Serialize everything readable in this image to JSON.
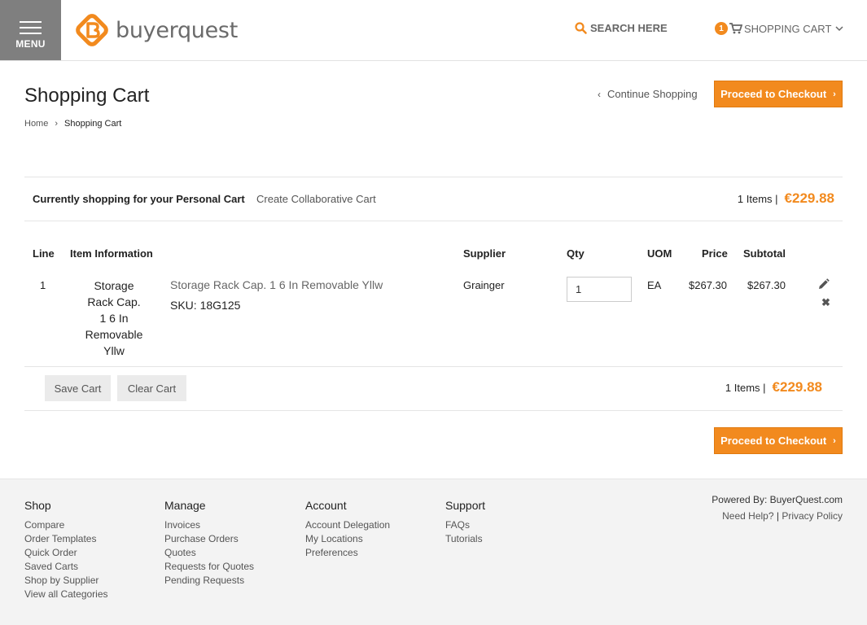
{
  "header": {
    "menu_label": "MENU",
    "logo_text": "buyerquest",
    "search_label": "SEARCH HERE",
    "cart_count": "1",
    "cart_label": "SHOPPING CART"
  },
  "page": {
    "title": "Shopping Cart",
    "breadcrumb": {
      "home": "Home",
      "current": "Shopping Cart"
    },
    "continue_label": "Continue Shopping",
    "checkout_label": "Proceed to Checkout"
  },
  "cart_bar": {
    "shopping_for": "Currently shopping for your Personal Cart",
    "collab_label": "Create Collaborative Cart",
    "items_label": "1 Items |",
    "total": "€229.88"
  },
  "table": {
    "headers": {
      "line": "Line",
      "item_info": "Item Information",
      "supplier": "Supplier",
      "qty": "Qty",
      "uom": "UOM",
      "price": "Price",
      "subtotal": "Subtotal"
    },
    "rows": [
      {
        "line": "1",
        "name_lines": [
          "Storage",
          "Rack Cap.",
          "1 6 In",
          "Removable",
          "Yllw"
        ],
        "link": "Storage Rack Cap. 1 6 In Removable Yllw",
        "sku": "SKU: 18G125",
        "supplier": "Grainger",
        "qty": "1",
        "uom": "EA",
        "price": "$267.30",
        "subtotal": "$267.30"
      }
    ]
  },
  "actions": {
    "save_label": "Save Cart",
    "clear_label": "Clear Cart"
  },
  "footer": {
    "shop": {
      "title": "Shop",
      "links": [
        "Compare",
        "Order Templates",
        "Quick Order",
        "Saved Carts",
        "Shop by Supplier",
        "View all Categories"
      ]
    },
    "manage": {
      "title": "Manage",
      "links": [
        "Invoices",
        "Purchase Orders",
        "Quotes",
        "Requests for Quotes",
        "Pending Requests"
      ]
    },
    "account": {
      "title": "Account",
      "links": [
        "Account Delegation",
        "My Locations",
        "Preferences"
      ]
    },
    "support": {
      "title": "Support",
      "links": [
        "FAQs",
        "Tutorials"
      ]
    },
    "powered_by": "Powered By: BuyerQuest.com",
    "need_help": "Need Help?",
    "separator": "|",
    "privacy": "Privacy Policy"
  },
  "colors": {
    "accent": "#f28a1e",
    "menu_bg": "#7f7f7f"
  },
  "icons": [
    "menu-icon",
    "logo-icon",
    "search-icon",
    "cart-icon",
    "chevron-down-icon",
    "chevron-left-icon",
    "chevron-right-icon",
    "edit-icon",
    "remove-icon"
  ]
}
